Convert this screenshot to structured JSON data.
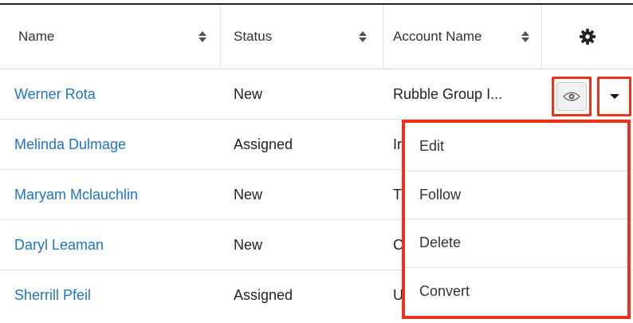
{
  "columns": {
    "name": "Name",
    "status": "Status",
    "account": "Account Name"
  },
  "header_icons": {
    "sort": "sort-arrows-icon",
    "settings": "gear-icon"
  },
  "rows": [
    {
      "name": "Werner Rota",
      "status": "New",
      "account": "Rubble Group I..."
    },
    {
      "name": "Melinda Dulmage",
      "status": "Assigned",
      "account": "Ir"
    },
    {
      "name": "Maryam Mclauchlin",
      "status": "New",
      "account": "T"
    },
    {
      "name": "Daryl Leaman",
      "status": "New",
      "account": "C"
    },
    {
      "name": "Sherrill Pfeil",
      "status": "Assigned",
      "account": "U"
    }
  ],
  "row_actions": {
    "preview_icon": "eye-icon",
    "dropdown_icon": "caret-down-icon"
  },
  "dropdown_menu": {
    "items": [
      "Edit",
      "Follow",
      "Delete",
      "Convert"
    ]
  },
  "colors": {
    "link": "#1f74c6",
    "highlight": "#e8321a"
  }
}
